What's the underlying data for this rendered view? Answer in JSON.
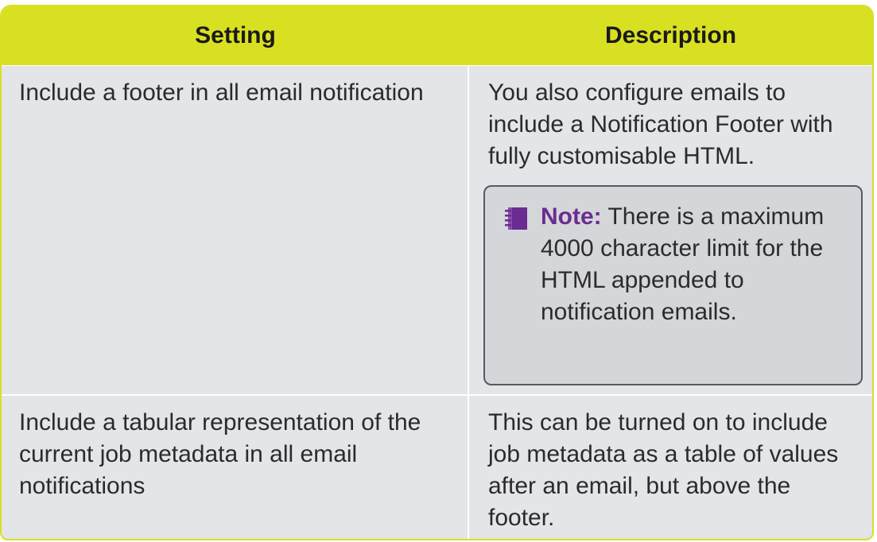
{
  "table": {
    "headers": [
      "Setting",
      "Description"
    ],
    "rows": [
      {
        "setting": "Include a footer in all email notification",
        "description": "You also configure emails to include a Notification Footer with fully customisable HTML.",
        "note": {
          "label": "Note:",
          "text": "There is a maximum 4000 character limit for the HTML appended to notification emails.",
          "icon": "notebook-icon"
        }
      },
      {
        "setting": "Include a tabular representation of the current job metadata in all email notifications",
        "description": "This can be turned on to include job metadata as a table of values after an email, but above the footer."
      }
    ]
  },
  "colors": {
    "header_bg": "#d9e021",
    "note_accent": "#6a2c91",
    "cell_bg": "#e3e5e8"
  }
}
